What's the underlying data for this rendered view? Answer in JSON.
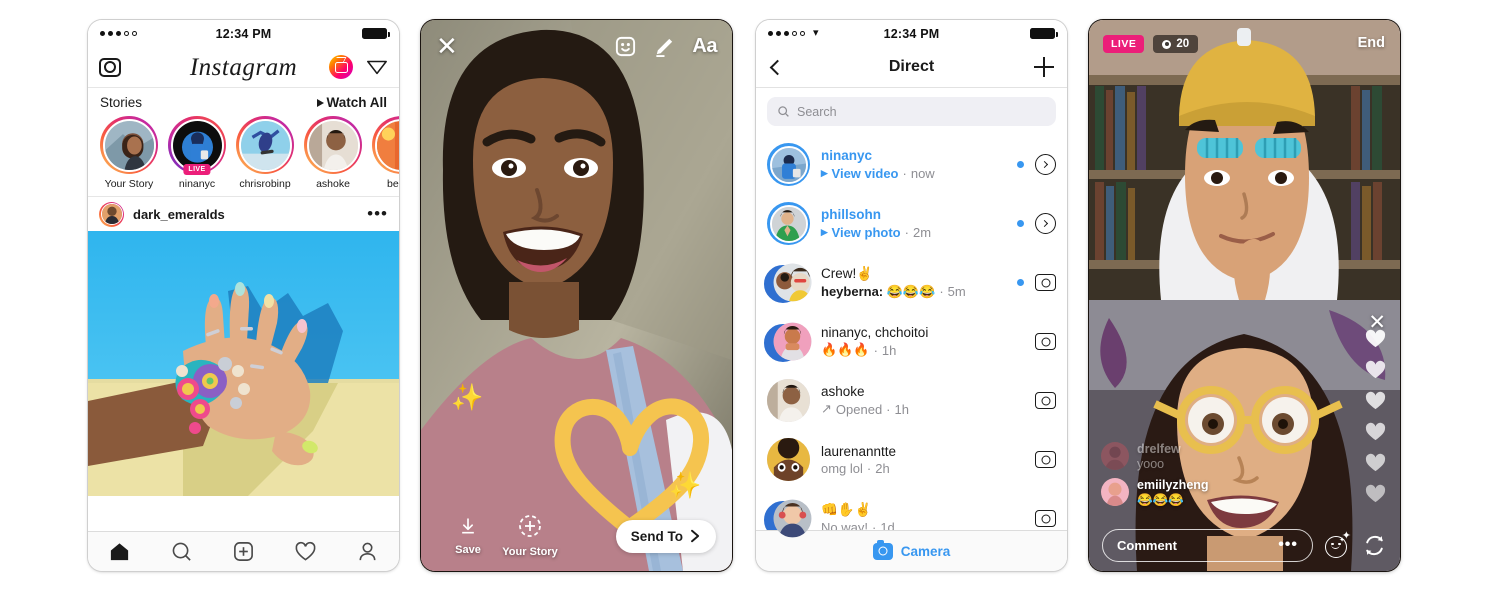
{
  "feed": {
    "status": {
      "time": "12:34 PM",
      "signal_dots": 5,
      "signal_filled": 3
    },
    "header": {
      "camera_icon": "camera-icon",
      "logo": "Instagram",
      "igtv_icon": "igtv-icon",
      "direct_icon": "paper-plane-icon"
    },
    "stories": {
      "title": "Stories",
      "watch_all": "Watch All",
      "items": [
        {
          "name": "Your Story",
          "live": false,
          "live_label": ""
        },
        {
          "name": "ninanyc",
          "live": true,
          "live_label": "LIVE"
        },
        {
          "name": "chrisrobinp",
          "live": false,
          "live_label": ""
        },
        {
          "name": "ashoke",
          "live": false,
          "live_label": ""
        },
        {
          "name": "benjin",
          "live": false,
          "live_label": ""
        }
      ]
    },
    "post": {
      "username": "dark_emeralds",
      "more_icon": "more-options-icon"
    },
    "tabbar": [
      {
        "icon": "home-icon",
        "active": true
      },
      {
        "icon": "search-icon",
        "active": false
      },
      {
        "icon": "add-post-icon",
        "active": false
      },
      {
        "icon": "activity-heart-icon",
        "active": false
      },
      {
        "icon": "profile-icon",
        "active": false
      }
    ]
  },
  "story_editor": {
    "close_label": "✕",
    "sticker_icon": "sticker-icon",
    "draw_icon": "pen-icon",
    "text_label": "Aa",
    "save_label": "Save",
    "your_story_label": "Your Story",
    "send_to_label": "Send To"
  },
  "direct": {
    "status": {
      "time": "12:34 PM"
    },
    "nav": {
      "back_icon": "back-chevron-icon",
      "title": "Direct",
      "new_message_icon": "new-message-plus-icon"
    },
    "search": {
      "placeholder": "Search",
      "icon": "search-icon"
    },
    "threads": [
      {
        "name": "ninanyc",
        "unread": true,
        "preview_prefix": "▸",
        "preview": "View video",
        "time": "now",
        "preview_style": "blue",
        "action_icon": "play-chevron-icon"
      },
      {
        "name": "phillsohn",
        "unread": true,
        "preview_prefix": "▸",
        "preview": "View photo",
        "time": "2m",
        "preview_style": "blue",
        "action_icon": "play-chevron-icon"
      },
      {
        "name": "Crew!✌️",
        "unread": true,
        "preview_prefix": "",
        "preview": "heyberna: 😂😂😂",
        "time": "5m",
        "preview_style": "bold",
        "action_icon": "camera-icon"
      },
      {
        "name": "ninanyc, chchoitoi",
        "unread": false,
        "preview_prefix": "",
        "preview": "🔥🔥🔥",
        "time": "1h",
        "preview_style": "plain",
        "action_icon": "camera-icon"
      },
      {
        "name": "ashoke",
        "unread": false,
        "preview_prefix": "↗",
        "preview": "Opened",
        "time": "1h",
        "preview_style": "plain",
        "action_icon": "camera-icon"
      },
      {
        "name": "laurenanntte",
        "unread": false,
        "preview_prefix": "",
        "preview": "omg lol",
        "time": "2h",
        "preview_style": "plain",
        "action_icon": "camera-icon"
      },
      {
        "name": "👊✋✌️",
        "unread": false,
        "preview_prefix": "",
        "preview": "No way!",
        "time": "1d",
        "preview_style": "plain",
        "action_icon": "camera-icon"
      }
    ],
    "footer": {
      "camera_label": "Camera",
      "camera_icon": "camera-icon"
    }
  },
  "live": {
    "live_label": "LIVE",
    "viewers": "20",
    "viewers_icon": "eye-icon",
    "end_label": "End",
    "close_guest_icon": "close-icon",
    "comments": [
      {
        "name": "drelfew",
        "message": "yooo",
        "faded": true
      },
      {
        "name": "emiilyzheng",
        "message": "😂😂😂",
        "faded": false
      }
    ],
    "comment_placeholder": "Comment",
    "more_icon": "more-options-icon",
    "filters_icon": "face-filters-icon",
    "switch_camera_icon": "switch-camera-icon",
    "hearts_count": 6
  },
  "colors": {
    "ig_blue": "#3897f0",
    "live_pink": "#ec1e79",
    "gradient_start": "#fdcb5c",
    "gradient_end": "#7232bd",
    "text_dark": "#1a1a1a",
    "text_muted": "#8e8e93"
  }
}
